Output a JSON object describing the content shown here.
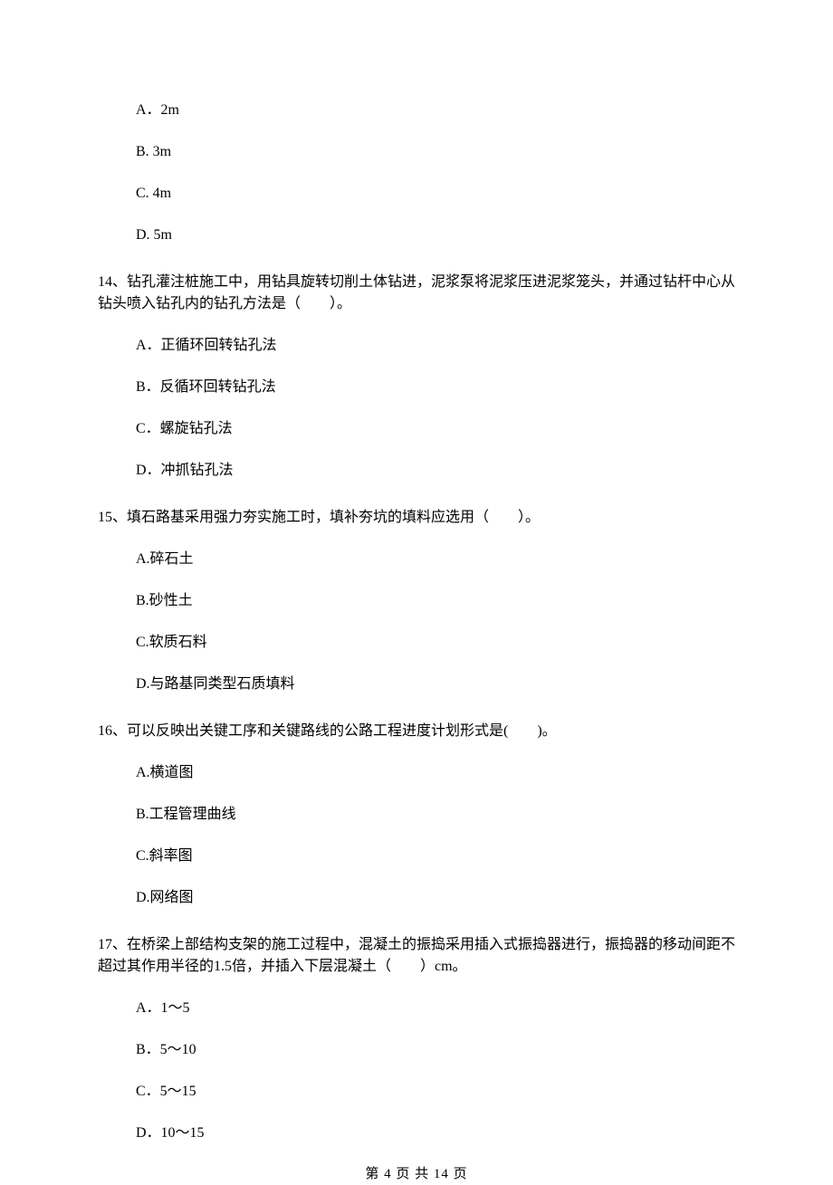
{
  "q13": {
    "optA": "A．2m",
    "optB": "B. 3m",
    "optC": "C. 4m",
    "optD": "D. 5m"
  },
  "q14": {
    "stem": "14、钻孔灌注桩施工中，用钻具旋转切削土体钻进，泥浆泵将泥浆压进泥浆笼头，并通过钻杆中心从钻头喷入钻孔内的钻孔方法是（　　）。",
    "optA": "A．正循环回转钻孔法",
    "optB": "B．反循环回转钻孔法",
    "optC": "C．螺旋钻孔法",
    "optD": "D．冲抓钻孔法"
  },
  "q15": {
    "stem": "15、填石路基采用强力夯实施工时，填补夯坑的填料应选用（　　）。",
    "optA": "A.碎石土",
    "optB": "B.砂性土",
    "optC": "C.软质石料",
    "optD": "D.与路基同类型石质填料"
  },
  "q16": {
    "stem": "16、可以反映出关键工序和关键路线的公路工程进度计划形式是(　　)。",
    "optA": "A.横道图",
    "optB": "B.工程管理曲线",
    "optC": "C.斜率图",
    "optD": "D.网络图"
  },
  "q17": {
    "stem": "17、在桥梁上部结构支架的施工过程中，混凝土的振捣采用插入式振捣器进行，振捣器的移动间距不超过其作用半径的1.5倍，并插入下层混凝土（　　）cm。",
    "optA": "A．1～5",
    "optB": "B．5～10",
    "optC": "C．5～15",
    "optD": "D．10～15"
  },
  "footer": "第 4 页 共 14 页"
}
